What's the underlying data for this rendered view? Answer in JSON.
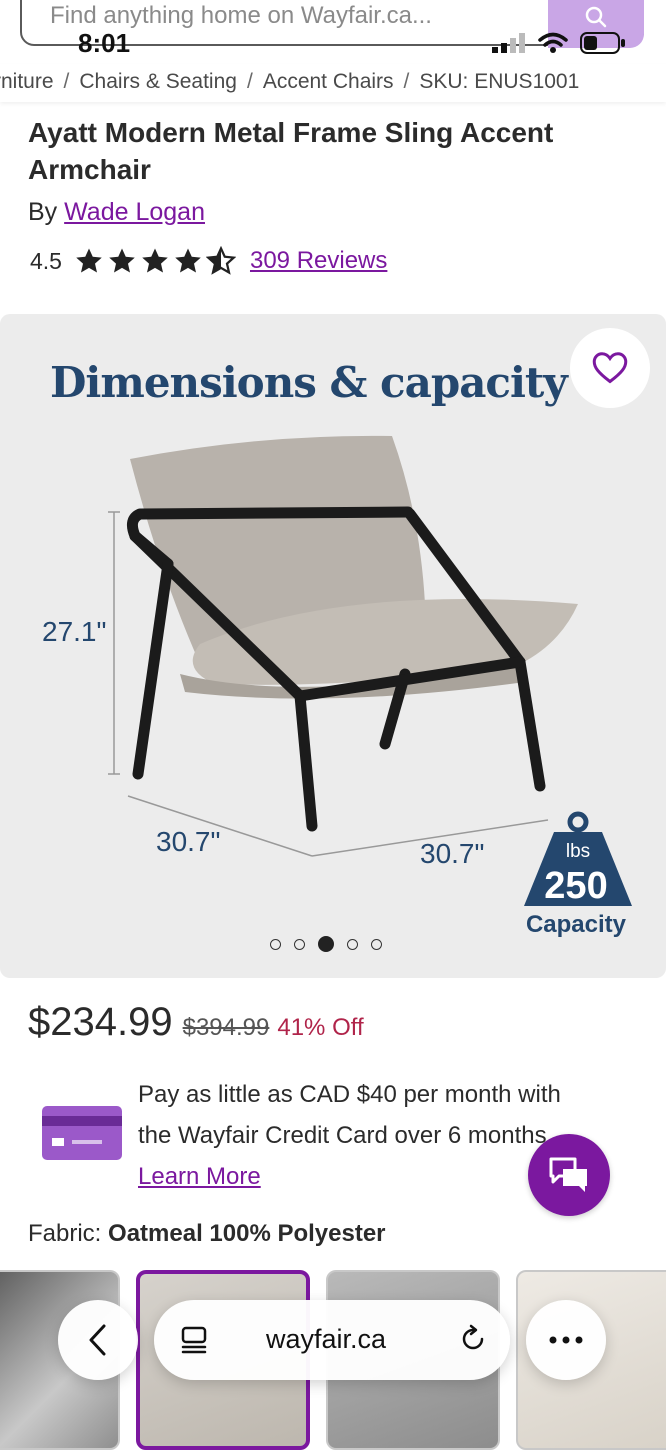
{
  "search": {
    "placeholder": "Find anything home on Wayfair.ca..."
  },
  "status_bar": {
    "time": "8:01"
  },
  "breadcrumb": {
    "items": [
      "rniture",
      "Chairs & Seating",
      "Accent Chairs",
      "SKU: ENUS1001"
    ],
    "separator": "/"
  },
  "product": {
    "title": "Ayatt Modern Metal Frame Sling Accent Armchair",
    "by_prefix": "By",
    "brand": "Wade Logan",
    "rating": "4.5",
    "rating_stars": 4.5,
    "reviews": "309 Reviews"
  },
  "gallery": {
    "heading": "Dimensions & capacity",
    "height": "27.1\"",
    "width": "30.7\"",
    "depth": "30.7\"",
    "capacity_unit": "lbs",
    "capacity_value": "250",
    "capacity_label": "Capacity",
    "image_count": 5,
    "active_index": 2
  },
  "pricing": {
    "price": "$234.99",
    "original_price": "$394.99",
    "discount": "41% Off"
  },
  "credit": {
    "line1": "Pay as little as CAD $40 per month with",
    "line2": "the Wayfair Credit Card over 6 months.",
    "link": "Learn More"
  },
  "fabric": {
    "label": "Fabric:",
    "value": "Oatmeal 100% Polyester"
  },
  "browser": {
    "url": "wayfair.ca"
  },
  "colors": {
    "brand_purple": "#7b189f",
    "heading_navy": "#24476e",
    "discount_red": "#b0244a",
    "gallery_bg": "#ececec"
  }
}
